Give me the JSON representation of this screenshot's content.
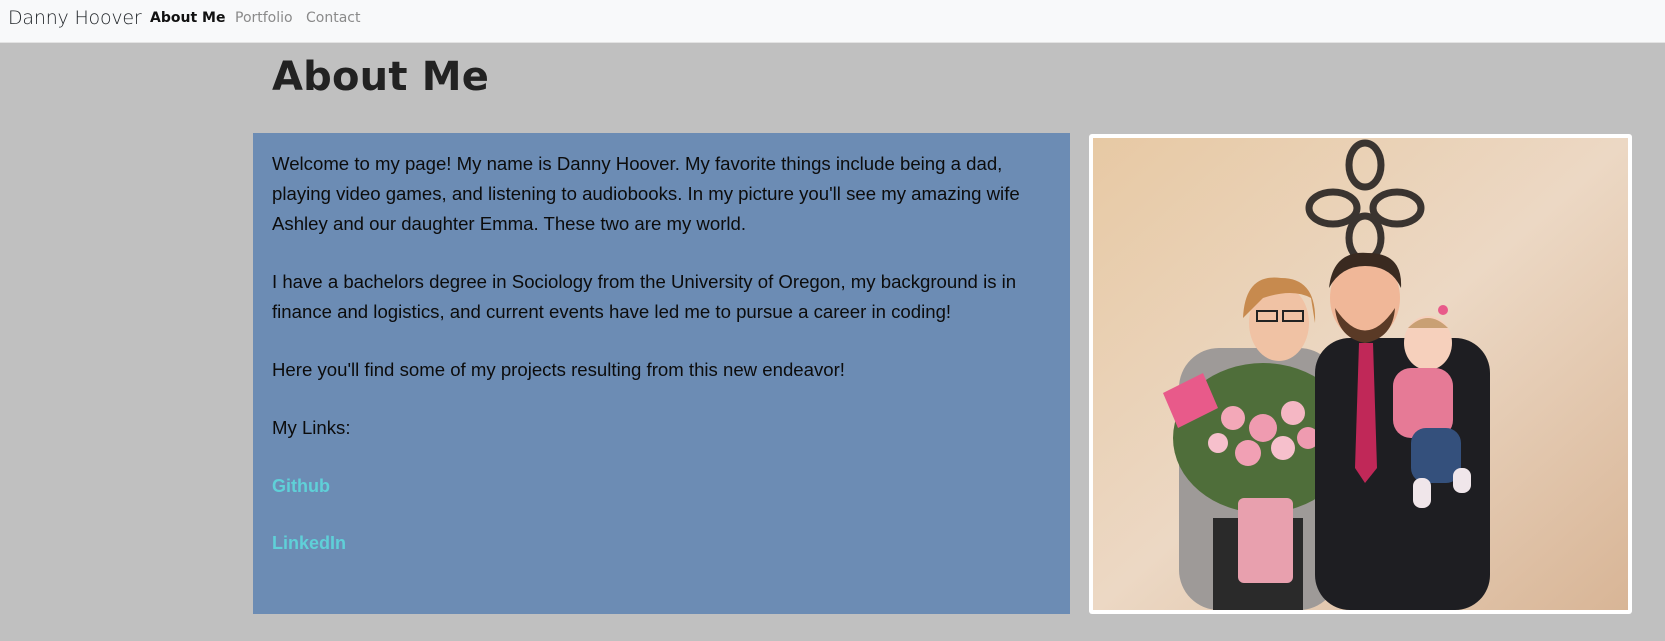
{
  "nav": {
    "brand": "Danny Hoover",
    "links": [
      {
        "label": "About Me",
        "active": true
      },
      {
        "label": "Portfolio",
        "active": false
      },
      {
        "label": "Contact",
        "active": false
      }
    ]
  },
  "main": {
    "title": "About Me",
    "paragraphs": [
      "Welcome to my page! My name is Danny Hoover. My favorite things include being a dad, playing video games, and listening to audiobooks. In my picture you'll see my amazing wife Ashley and our daughter Emma. These two are my world.",
      "I have a bachelors degree in Sociology from the University of Oregon, my background is in finance and logistics, and current events have led me to pursue a career in coding!",
      "Here you'll find some of my projects resulting from this new endeavor!",
      "My Links:"
    ],
    "links": [
      {
        "label": "Github"
      },
      {
        "label": "LinkedIn"
      }
    ]
  },
  "photo": {
    "alt": "family photo"
  },
  "colors": {
    "background": "#c0c0c0",
    "about_box": "#6c8cb4",
    "link": "#5fd0d8",
    "navbar": "#f8f9fa"
  }
}
